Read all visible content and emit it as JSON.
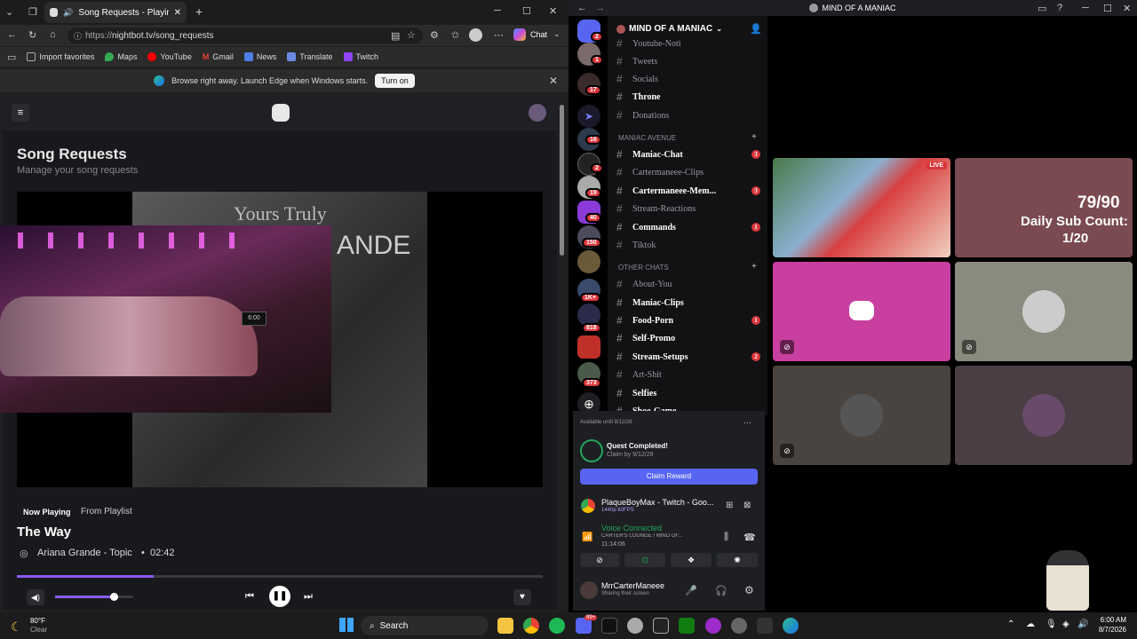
{
  "browser": {
    "tab_title": "Song Requests - Playing The Way",
    "url_prefix": "https://",
    "url": "nightbot.tv/song_requests",
    "chat_label": "Chat",
    "favorites": [
      "Import favorites",
      "Maps",
      "YouTube",
      "Gmail",
      "News",
      "Translate",
      "Twitch"
    ],
    "info_text": "Browse right away. Launch Edge when Windows starts.",
    "turn_on_label": "Turn on"
  },
  "nightbot": {
    "title": "Song Requests",
    "subtitle": "Manage your song requests",
    "video_title_overlay": "Yours Truly",
    "video_artist_overlay": "ANDE",
    "cam_clock": "6:00",
    "now_playing_label": "Now Playing",
    "source_label": "From Playlist",
    "song_title": "The Way",
    "artist_line": "Ariana Grande - Topic",
    "duration": "02:42",
    "progress_fraction": 0.26,
    "volume_fraction": 0.75
  },
  "discord": {
    "window_title": "MIND OF A MANIAC",
    "server_name": "MIND OF A MANIAC",
    "server_badges": [
      "2",
      "1",
      "17",
      "",
      "16",
      "2",
      "19",
      "40",
      "150",
      "",
      "1K+",
      "818",
      "",
      "373"
    ],
    "channels_top": [
      {
        "name": "Youtube-Noti",
        "bold": false
      },
      {
        "name": "Tweets",
        "bold": false
      },
      {
        "name": "Socials",
        "bold": false
      },
      {
        "name": "Throne",
        "bold": true
      },
      {
        "name": "Donations",
        "bold": false
      }
    ],
    "category_1": "MANIAC AVENUE",
    "channels_mid": [
      {
        "name": "Maniac-Chat",
        "bold": true,
        "badge": "3"
      },
      {
        "name": "Cartermaneee-Clips",
        "bold": false,
        "badge": ""
      },
      {
        "name": "Cartermaneee-Mem...",
        "bold": true,
        "badge": "3"
      },
      {
        "name": "Stream-Reactions",
        "bold": false,
        "badge": ""
      },
      {
        "name": "Commands",
        "bold": true,
        "badge": "1"
      },
      {
        "name": "Tiktok",
        "bold": false,
        "badge": ""
      }
    ],
    "category_2": "OTHER CHATS",
    "channels_bot": [
      {
        "name": "About-You",
        "bold": false,
        "badge": ""
      },
      {
        "name": "Maniac-Clips",
        "bold": true,
        "badge": ""
      },
      {
        "name": "Food-Porn",
        "bold": true,
        "badge": "1"
      },
      {
        "name": "Self-Promo",
        "bold": true,
        "badge": ""
      },
      {
        "name": "Stream-Setups",
        "bold": true,
        "badge": "2"
      },
      {
        "name": "Art-Shit",
        "bold": false,
        "badge": ""
      },
      {
        "name": "Selfies",
        "bold": true,
        "badge": ""
      },
      {
        "name": "Shoe-Game",
        "bold": true,
        "badge": ""
      }
    ],
    "quest_available": "Available until 8/12/26",
    "quest_title": "Quest Completed!",
    "quest_claim_by": "Claim by 9/12/26",
    "claim_label": "Claim Reward",
    "activity_name": "PlaqueBoyMax - Twitch - Goo...",
    "activity_sub": "1440p 60FPS",
    "voice_status": "Voice Connected",
    "voice_channel": "CARTER'S LOUNGE / MIND OF...",
    "voice_time": "11:14:06",
    "username": "MrrCarterManeee",
    "user_status": "Sharing their screen",
    "live_label": "LIVE",
    "sub_count_top": "79/90",
    "sub_count_label": "Daily Sub Count:",
    "sub_count_bottom": "1/20"
  },
  "taskbar": {
    "weather_temp": "80°F",
    "weather_cond": "Clear",
    "search_label": "Search",
    "time": "6:00 AM",
    "date": "8/7/2026",
    "notif_badge": "99+"
  },
  "colors": {
    "discord_blurple": "#5865f2",
    "badge_red": "#da373c",
    "voice_green": "#23a55a",
    "nightbot_purple": "#8a5cf5"
  }
}
